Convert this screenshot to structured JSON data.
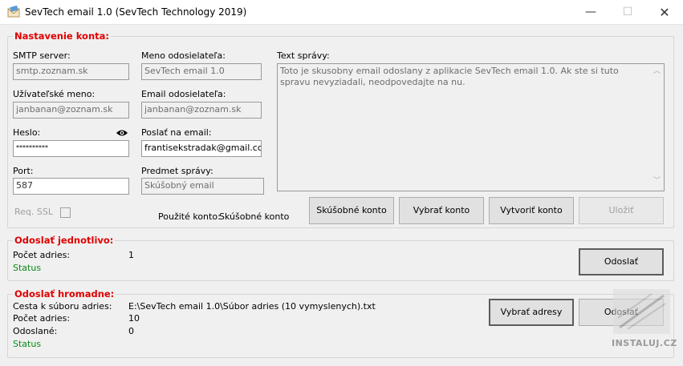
{
  "window": {
    "title": "SevTech email 1.0 (SevTech Technology 2019)",
    "minimize": "—",
    "maximize": "☐",
    "close": "✕"
  },
  "account": {
    "legend": "Nastavenie konta:",
    "smtp_label": "SMTP server:",
    "smtp_value": "smtp.zoznam.sk",
    "user_label": "Užívateľské meno:",
    "user_value": "janbanan@zoznam.sk",
    "password_label": "Heslo:",
    "password_value": "**********",
    "port_label": "Port:",
    "port_value": "587",
    "ssl_label": "Req. SSL",
    "sender_name_label": "Meno odosielateľa:",
    "sender_name_value": "SevTech email 1.0",
    "sender_email_label": "Email odosielateľa:",
    "sender_email_value": "janbanan@zoznam.sk",
    "send_to_label": "Poslať na email:",
    "send_to_value": "frantisekstradak@gmail.com",
    "subject_label": "Predmet správy:",
    "subject_value": "Skúšobný email",
    "used_account_label": "Použité konto:",
    "used_account_value": "Skúšobné konto",
    "message_label": "Text správy:",
    "message_value": "Toto je skusobny email odoslany z aplikacie SevTech email 1.0. Ak ste si tuto spravu nevyziadali, neodpovedajte na nu.",
    "btn_test_account": "Skúšobné konto",
    "btn_choose_account": "Vybrať konto",
    "btn_create_account": "Vytvoriť konto",
    "btn_save": "Uložiť"
  },
  "single": {
    "legend": "Odoslať jednotlivo:",
    "count_label": "Počet adries:",
    "count_value": "1",
    "status": "Status",
    "btn_send": "Odoslať"
  },
  "bulk": {
    "legend": "Odoslať hromadne:",
    "path_label": "Cesta k súboru adries:",
    "path_value": "E:\\SevTech email 1.0\\Súbor adries (10 vymyslenych).txt",
    "count_label": "Počet adries:",
    "count_value": "10",
    "sent_label": "Odoslané:",
    "sent_value": "0",
    "status": "Status",
    "btn_choose": "Vybrať adresy",
    "btn_send": "Odoslať"
  },
  "watermark": {
    "text": "INSTALUJ.CZ"
  },
  "colors": {
    "legend": "#e00000",
    "status": "#0a8a16"
  },
  "icons": {
    "app": "envelope-icon",
    "password_toggle": "eye-icon"
  }
}
